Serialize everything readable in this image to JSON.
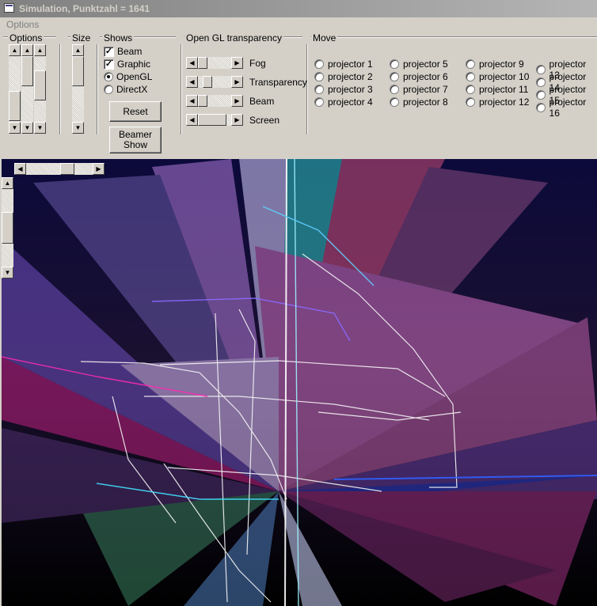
{
  "window": {
    "title": "Simulation, Punktzahl = 1641"
  },
  "menu": {
    "options": "Options"
  },
  "groups": {
    "options": "Options",
    "size": "Size",
    "shows": "Shows",
    "opengl": "Open GL transparency",
    "move": "Move"
  },
  "shows": {
    "beam": {
      "label": "Beam",
      "checked": true
    },
    "graphic": {
      "label": "Graphic",
      "checked": true
    },
    "opengl": {
      "label": "OpenGL",
      "selected": true
    },
    "directx": {
      "label": "DirectX",
      "selected": false
    }
  },
  "buttons": {
    "reset": "Reset",
    "beamer_show_1": "Beamer",
    "beamer_show_2": "Show"
  },
  "sliders": {
    "fog": {
      "label": "Fog",
      "level": 0.1
    },
    "transparency": {
      "label": "Transparency",
      "level": 0.25
    },
    "beam": {
      "label": "Beam",
      "level": 0.1
    },
    "screen": {
      "label": "Screen",
      "level": 0.0
    }
  },
  "projectors": [
    "projector 1",
    "projector 2",
    "projector 3",
    "projector 4",
    "projector 5",
    "projector 6",
    "projector 7",
    "projector 8",
    "projector 9",
    "projector 10",
    "projector 11",
    "projector 12",
    "projector 13",
    "projector 14",
    "projector 15",
    "projector 16"
  ],
  "icons": {
    "scroll_up": "arrow-up-icon",
    "scroll_down": "arrow-down-icon",
    "scroll_left": "arrow-left-icon",
    "scroll_right": "arrow-right-icon"
  },
  "colors": {
    "dialog": "#d4d0c8",
    "title_inactive": "#808080",
    "viewport": "#000000"
  }
}
